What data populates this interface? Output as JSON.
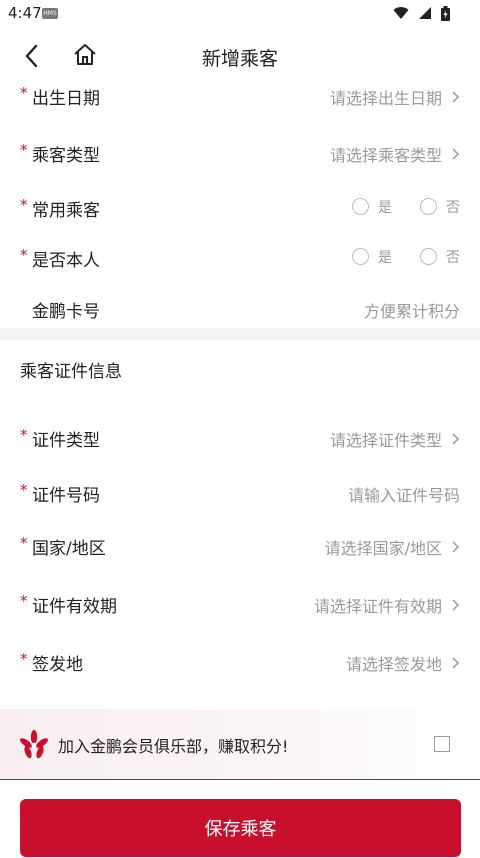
{
  "status_bar": {
    "time": "4:47",
    "badge": "HMS"
  },
  "nav": {
    "title": "新增乘客"
  },
  "passenger": {
    "birth_date": {
      "required": "*",
      "label": "出生日期",
      "placeholder": "请选择出生日期"
    },
    "passenger_type": {
      "required": "*",
      "label": "乘客类型",
      "placeholder": "请选择乘客类型"
    },
    "frequent": {
      "required": "*",
      "label": "常用乘客",
      "yes": "是",
      "no": "否"
    },
    "self": {
      "required": "*",
      "label": "是否本人",
      "yes": "是",
      "no": "否"
    },
    "card_no": {
      "label": "金鹏卡号",
      "placeholder": "方便累计积分"
    }
  },
  "document": {
    "title": "乘客证件信息",
    "doc_type": {
      "required": "*",
      "label": "证件类型",
      "placeholder": "请选择证件类型"
    },
    "doc_number": {
      "required": "*",
      "label": "证件号码",
      "placeholder": "请输入证件号码"
    },
    "country": {
      "required": "*",
      "label": "国家/地区",
      "placeholder": "请选择国家/地区"
    },
    "expiry": {
      "required": "*",
      "label": "证件有效期",
      "placeholder": "请选择证件有效期"
    },
    "issue_place": {
      "required": "*",
      "label": "签发地",
      "placeholder": "请选择签发地"
    }
  },
  "promo": {
    "text": "加入金鹏会员俱乐部，赚取积分!",
    "checked": false
  },
  "actions": {
    "save_label": "保存乘客"
  },
  "colors": {
    "brand": "#c8102e",
    "placeholder": "#9a9a9a",
    "section_gap": "#f5f5f5"
  }
}
